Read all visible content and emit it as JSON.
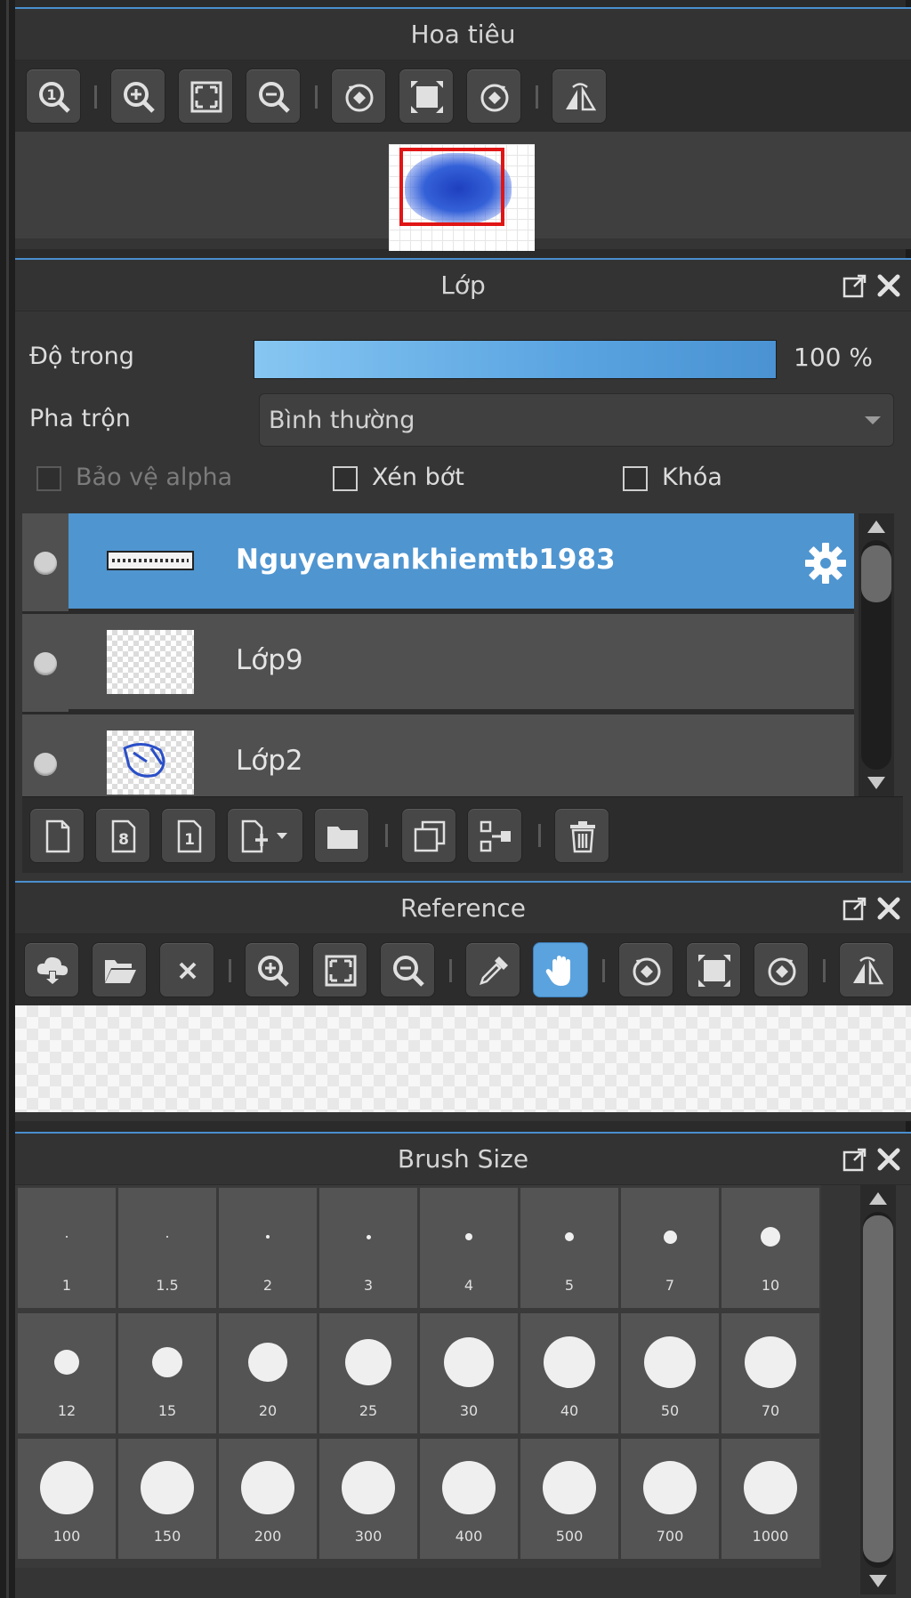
{
  "navigator": {
    "title": "Hoa tiêu",
    "tools": [
      {
        "name": "zoom-actual-icon"
      },
      {
        "name": "zoom-in-icon"
      },
      {
        "name": "fit-screen-icon"
      },
      {
        "name": "zoom-out-icon"
      },
      {
        "name": "rotate-left-icon"
      },
      {
        "name": "reset-view-icon"
      },
      {
        "name": "rotate-right-icon"
      },
      {
        "name": "flip-horizontal-icon"
      }
    ]
  },
  "layers": {
    "title": "Lớp",
    "opacity_label": "Độ trong",
    "opacity_value": "100 %",
    "opacity_fraction": 1.0,
    "blend_label": "Pha trộn",
    "blend_value": "Bình thường",
    "protect_alpha": "Bảo vệ alpha",
    "clipping": "Xén bớt",
    "lock": "Khóa",
    "items": [
      {
        "name": "Nguyenvankhiemtb1983",
        "selected": true
      },
      {
        "name": "Lớp9",
        "selected": false
      },
      {
        "name": "Lớp2",
        "selected": false
      }
    ]
  },
  "reference": {
    "title": "Reference"
  },
  "brush_size": {
    "title": "Brush Size",
    "sizes": [
      "1",
      "1.5",
      "2",
      "3",
      "4",
      "5",
      "7",
      "10",
      "12",
      "15",
      "20",
      "25",
      "30",
      "40",
      "50",
      "70",
      "100",
      "150",
      "200",
      "300",
      "400",
      "500",
      "700",
      "1000"
    ]
  },
  "colors": {
    "accent": "#4f95d0",
    "panel": "#353535",
    "toolbar": "#2c2c2c",
    "button": "#474747"
  }
}
